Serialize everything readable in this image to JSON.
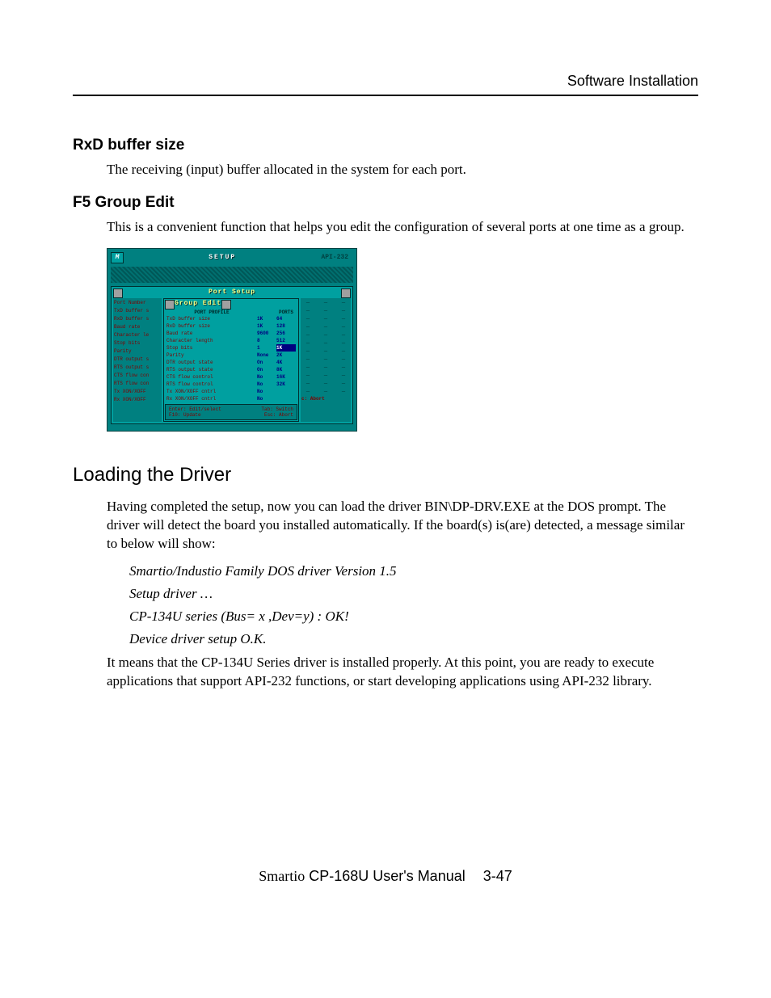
{
  "header": {
    "title": "Software Installation"
  },
  "sections": {
    "rxd": {
      "heading": "RxD buffer size",
      "body": "The receiving (input) buffer allocated in the system for each port."
    },
    "f5": {
      "heading": "F5 Group Edit",
      "body": "This is a convenient function that helps you edit the configuration of several ports at one time as a group."
    },
    "loading": {
      "heading": "Loading the Driver",
      "p1": "Having completed the setup, now you can load the driver BIN\\DP-DRV.EXE at the DOS prompt. The driver will detect the board you installed automatically. If the board(s) is(are) detected, a message similar to below will show:",
      "msg1": "Smartio/Industio Family DOS driver Version 1.5",
      "msg2": "Setup driver …",
      "msg3": "CP-134U series (Bus= x ,Dev=y) : OK!",
      "msg4": "Device driver setup O.K.",
      "p2": "It means that the CP-134U Series driver is installed properly. At this point, you are ready to execute applications that support API-232 functions, or start developing applications using API-232 library."
    }
  },
  "terminal": {
    "logo": "M",
    "title": "SETUP",
    "api": "API-232",
    "port_setup_title": "Port Setup",
    "group_edit_title": "Group Edit",
    "col_profile": "PORT PROFILE",
    "col_ports": "PORTS",
    "left_labels": [
      "Port Number",
      "TxD buffer s",
      "RxD buffer s",
      "Baud rate",
      "Character le",
      "Stop bits",
      "Parity",
      "DTR output s",
      "RTS output s",
      "CTS flow con",
      "RTS flow con",
      "Tx XON/XOFF",
      "Rx XON/XOFF"
    ],
    "profile_rows": [
      {
        "label": "TxD buffer size",
        "val": "1K",
        "opt": "64",
        "hl": false
      },
      {
        "label": "RxD buffer size",
        "val": "1K",
        "opt": "128",
        "hl": false
      },
      {
        "label": "Baud rate",
        "val": "9600",
        "opt": "256",
        "hl": false
      },
      {
        "label": "Character length",
        "val": "8",
        "opt": "512",
        "hl": false
      },
      {
        "label": "Stop bits",
        "val": "1",
        "opt": "1K",
        "hl": true
      },
      {
        "label": "Parity",
        "val": "None",
        "opt": "2K",
        "hl": false
      },
      {
        "label": "DTR output state",
        "val": "On",
        "opt": "4K",
        "hl": false
      },
      {
        "label": "RTS output state",
        "val": "On",
        "opt": "8K",
        "hl": false
      },
      {
        "label": "CTS flow control",
        "val": "No",
        "opt": "16K",
        "hl": false
      },
      {
        "label": "RTS flow control",
        "val": "No",
        "opt": "32K",
        "hl": false
      },
      {
        "label": "Tx XON/XOFF cntrl",
        "val": "No",
        "opt": "",
        "hl": false
      },
      {
        "label": "Rx XON/XOFF cntrl",
        "val": "No",
        "opt": "",
        "hl": false
      }
    ],
    "abort": "c: Abort",
    "hints": {
      "r1a": "Enter: Edit/select",
      "r1b": "Tab: Switch",
      "r2a": "F10: Update",
      "r2b": "Esc: Abort"
    }
  },
  "footer": {
    "smartio": "Smartio",
    "manual": " CP-168U User's Manual",
    "page": "3-47"
  }
}
